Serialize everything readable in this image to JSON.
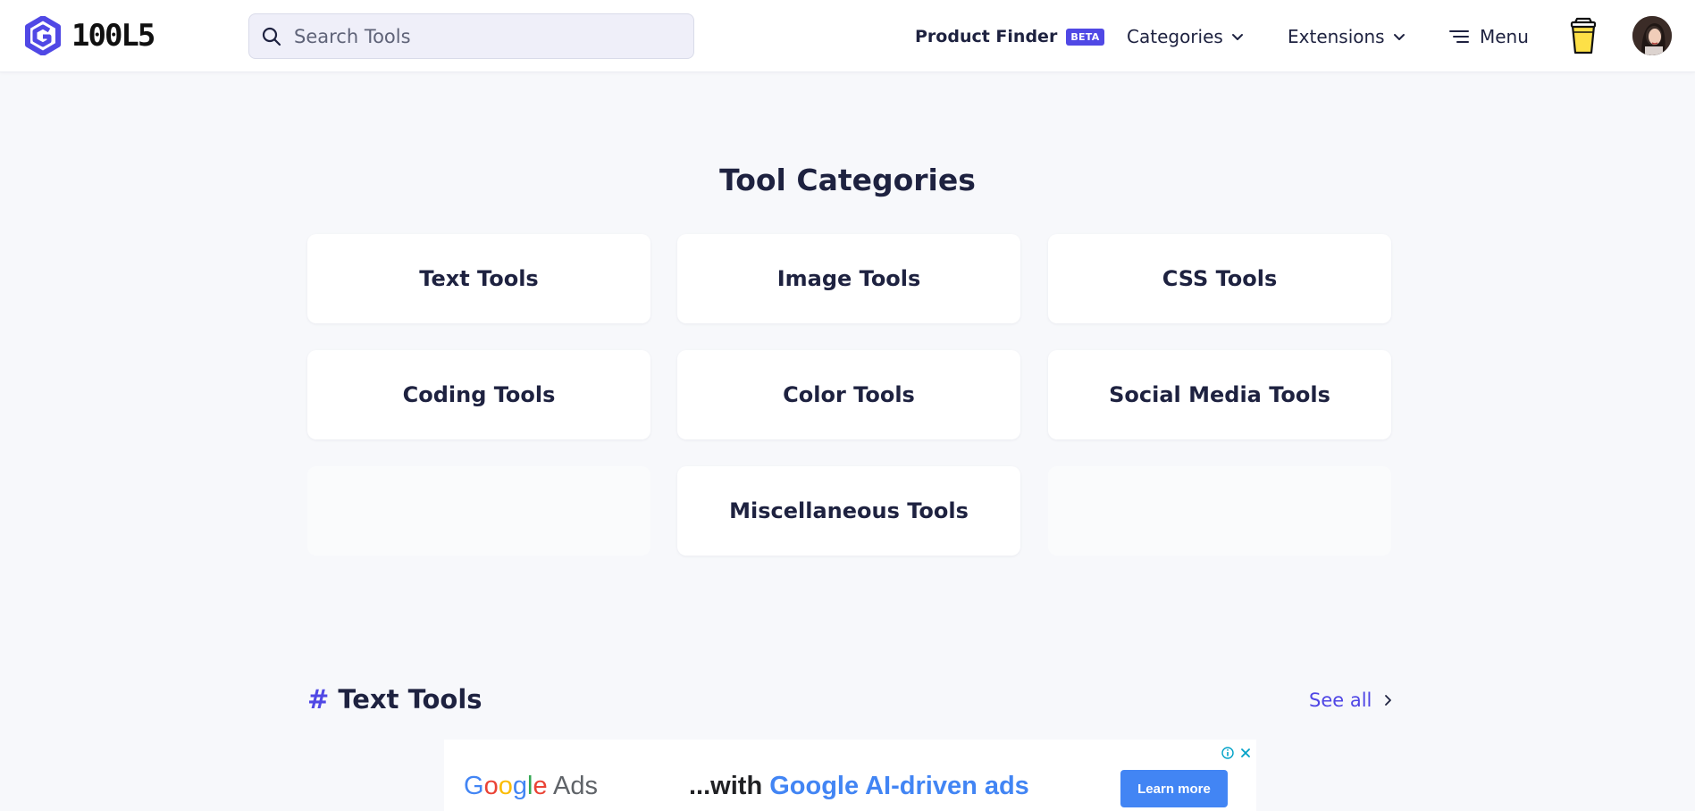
{
  "header": {
    "logo_text": "100L5",
    "search": {
      "placeholder": "Search Tools",
      "value": ""
    },
    "nav": {
      "product_finder": "Product Finder",
      "beta_badge": "BETA",
      "categories": "Categories",
      "extensions": "Extensions",
      "menu": "Menu"
    }
  },
  "main": {
    "title": "Tool Categories",
    "categories": [
      "Text Tools",
      "Image Tools",
      "CSS Tools",
      "Coding Tools",
      "Color Tools",
      "Social Media Tools",
      "",
      "Miscellaneous Tools",
      ""
    ],
    "section": {
      "title": "Text Tools",
      "hash": "#",
      "see_all": "See all"
    }
  },
  "ad": {
    "brand_google": [
      "G",
      "o",
      "o",
      "g",
      "l",
      "e"
    ],
    "brand_ads": "Ads",
    "tagline_prefix": "...with",
    "tagline_highlight": "Google AI-driven ads",
    "button": "Learn more"
  },
  "colors": {
    "accent": "#5048e5",
    "text": "#1e2240",
    "background": "#f7f8fb"
  }
}
